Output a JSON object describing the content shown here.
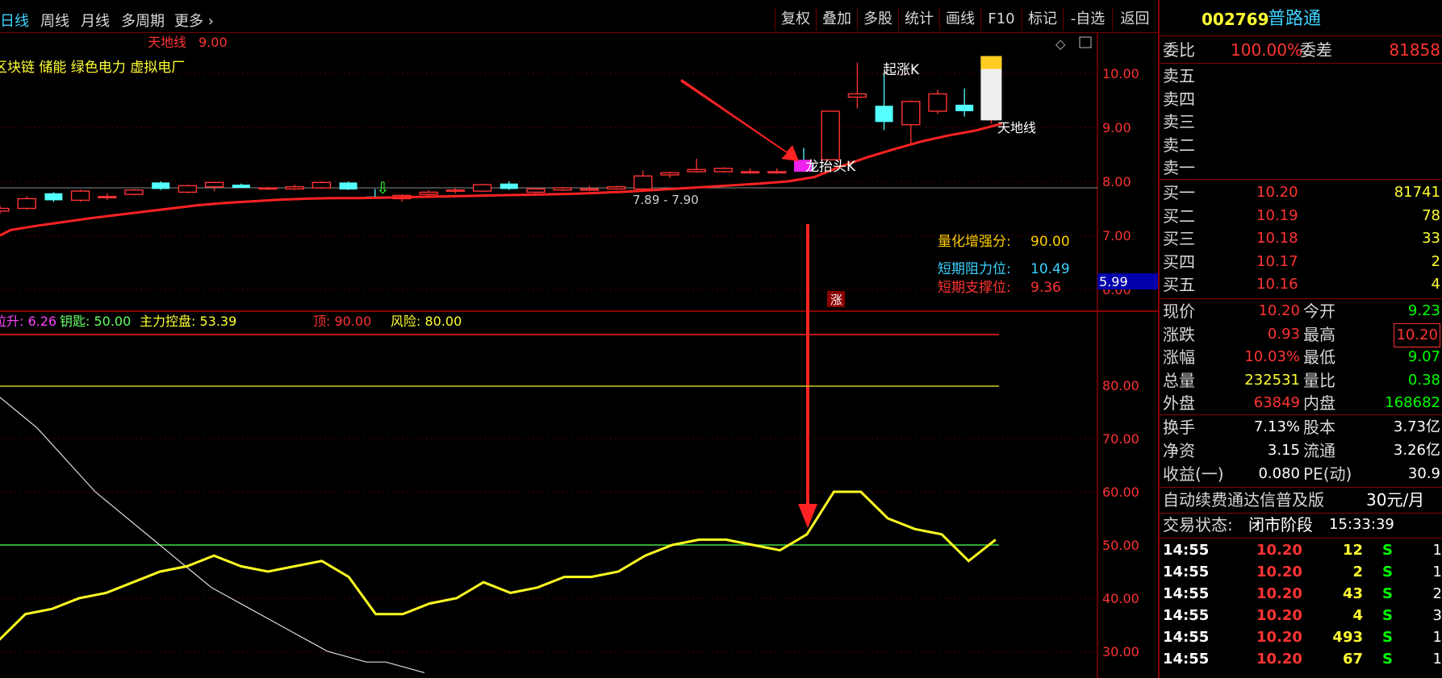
{
  "toolbar": {
    "periods": [
      "日线",
      "周线",
      "月线",
      "多周期",
      "更多"
    ],
    "buttons": [
      "复权",
      "叠加",
      "多股",
      "统计",
      "画线",
      "F10",
      "标记",
      "-自选",
      "返回"
    ]
  },
  "main_chart": {
    "indicator_label": "天地线",
    "indicator_value": "9.00",
    "concepts": "区块链 储能 绿色电力 虚拟电厂",
    "annotations": {
      "dragon_head": "龙抬头K",
      "rise_k": "起涨K",
      "tiandi_line": "天地线",
      "range": "7.89 - 7.90",
      "up_badge": "涨"
    },
    "y_axis_ticks": [
      "10.00",
      "9.00",
      "8.00",
      "7.00",
      "6.00"
    ],
    "cursor_value": "5.99",
    "info": [
      {
        "label": "量化增强分:",
        "value": "90.00",
        "color": "#ffcc00"
      },
      {
        "label": "短期阻力位:",
        "value": "10.49",
        "color": "#3cd2ff"
      },
      {
        "label": "短期支撑位:",
        "value": "9.36",
        "color": "#ff3333"
      }
    ]
  },
  "sub_chart": {
    "legend": [
      {
        "label": "拉升:",
        "value": "6.26",
        "color": "#ff44ff"
      },
      {
        "label": "钥匙:",
        "value": "50.00",
        "color": "#66ff66"
      },
      {
        "label": "主力控盘:",
        "value": "53.39",
        "color": "#ffff33"
      },
      {
        "label": "顶:",
        "value": "90.00",
        "color": "#ff3333"
      },
      {
        "label": "风险:",
        "value": "80.00",
        "color": "#ffff33"
      }
    ],
    "y_axis_ticks": [
      "80.00",
      "70.00",
      "60.00",
      "50.00",
      "40.00",
      "30.00"
    ]
  },
  "quote": {
    "code": "002769",
    "name": "普路通",
    "webi": {
      "label": "委比",
      "value": "100.00%",
      "label2": "委差",
      "value2": "81858"
    },
    "asks": [
      {
        "label": "卖五"
      },
      {
        "label": "卖四"
      },
      {
        "label": "卖三"
      },
      {
        "label": "卖二"
      },
      {
        "label": "卖一"
      }
    ],
    "bids": [
      {
        "label": "买一",
        "price": "10.20",
        "vol": "81741"
      },
      {
        "label": "买二",
        "price": "10.19",
        "vol": "78"
      },
      {
        "label": "买三",
        "price": "10.18",
        "vol": "33"
      },
      {
        "label": "买四",
        "price": "10.17",
        "vol": "2"
      },
      {
        "label": "买五",
        "price": "10.16",
        "vol": "4"
      }
    ],
    "stats": [
      {
        "l1": "现价",
        "v1": "10.20",
        "c1": "#ff3333",
        "l2": "今开",
        "v2": "9.23",
        "c2": "#00ff00"
      },
      {
        "l1": "涨跌",
        "v1": "0.93",
        "c1": "#ff3333",
        "l2": "最高",
        "v2": "10.20",
        "c2": "#ff3333"
      },
      {
        "l1": "涨幅",
        "v1": "10.03%",
        "c1": "#ff3333",
        "l2": "最低",
        "v2": "9.07",
        "c2": "#00ff00"
      },
      {
        "l1": "总量",
        "v1": "232531",
        "c1": "#ffff33",
        "l2": "量比",
        "v2": "0.38",
        "c2": "#00ff00"
      },
      {
        "l1": "外盘",
        "v1": "63849",
        "c1": "#ff3333",
        "l2": "内盘",
        "v2": "168682",
        "c2": "#00ff00"
      }
    ],
    "fundamentals": [
      {
        "l1": "换手",
        "v1": "7.13%",
        "l2": "股本",
        "v2": "3.73亿"
      },
      {
        "l1": "净资",
        "v1": "3.15",
        "l2": "流通",
        "v2": "3.26亿"
      },
      {
        "l1": "收益(一)",
        "v1": "0.080",
        "l2": "PE(动)",
        "v2": "30.9"
      }
    ],
    "notice": {
      "text": "自动续费通达信普及版",
      "price": "30元/月"
    },
    "trade_state": {
      "label": "交易状态:",
      "value": "闭市阶段",
      "time": "15:33:39"
    },
    "ticks": [
      {
        "time": "14:55",
        "price": "10.20",
        "vol": "12",
        "side": "S",
        "n": "1"
      },
      {
        "time": "14:55",
        "price": "10.20",
        "vol": "2",
        "side": "S",
        "n": "1"
      },
      {
        "time": "14:55",
        "price": "10.20",
        "vol": "43",
        "side": "S",
        "n": "2"
      },
      {
        "time": "14:55",
        "price": "10.20",
        "vol": "4",
        "side": "S",
        "n": "3"
      },
      {
        "time": "14:55",
        "price": "10.20",
        "vol": "493",
        "side": "S",
        "n": "1"
      },
      {
        "time": "14:55",
        "price": "10.20",
        "vol": "67",
        "side": "S",
        "n": "1"
      }
    ]
  },
  "chart_data": [
    {
      "type": "candlestick",
      "ylim": [
        6.0,
        10.3
      ],
      "candles": [
        {
          "o": 7.45,
          "h": 7.55,
          "l": 7.4,
          "c": 7.5
        },
        {
          "o": 7.5,
          "h": 7.72,
          "l": 7.48,
          "c": 7.68
        },
        {
          "o": 7.78,
          "h": 7.8,
          "l": 7.62,
          "c": 7.65
        },
        {
          "o": 7.65,
          "h": 7.85,
          "l": 7.62,
          "c": 7.82
        },
        {
          "o": 7.72,
          "h": 7.78,
          "l": 7.66,
          "c": 7.72
        },
        {
          "o": 7.76,
          "h": 7.86,
          "l": 7.74,
          "c": 7.84
        },
        {
          "o": 7.98,
          "h": 8.0,
          "l": 7.84,
          "c": 7.86
        },
        {
          "o": 7.8,
          "h": 7.94,
          "l": 7.78,
          "c": 7.92
        },
        {
          "o": 7.9,
          "h": 8.0,
          "l": 7.82,
          "c": 7.98
        },
        {
          "o": 7.94,
          "h": 7.96,
          "l": 7.88,
          "c": 7.88
        },
        {
          "o": 7.87,
          "h": 7.9,
          "l": 7.85,
          "c": 7.88
        },
        {
          "o": 7.86,
          "h": 7.94,
          "l": 7.84,
          "c": 7.9
        },
        {
          "o": 7.88,
          "h": 8.0,
          "l": 7.86,
          "c": 7.98
        },
        {
          "o": 7.98,
          "h": 8.0,
          "l": 7.84,
          "c": 7.85
        },
        {
          "o": 7.72,
          "h": 7.86,
          "l": 7.68,
          "c": 7.7
        },
        {
          "o": 7.68,
          "h": 7.76,
          "l": 7.62,
          "c": 7.74
        },
        {
          "o": 7.76,
          "h": 7.84,
          "l": 7.72,
          "c": 7.8
        },
        {
          "o": 7.82,
          "h": 7.88,
          "l": 7.78,
          "c": 7.84
        },
        {
          "o": 7.82,
          "h": 7.94,
          "l": 7.8,
          "c": 7.94
        },
        {
          "o": 7.96,
          "h": 8.0,
          "l": 7.84,
          "c": 7.86
        },
        {
          "o": 7.8,
          "h": 7.88,
          "l": 7.76,
          "c": 7.86
        },
        {
          "o": 7.84,
          "h": 7.9,
          "l": 7.82,
          "c": 7.88
        },
        {
          "o": 7.86,
          "h": 7.92,
          "l": 7.82,
          "c": 7.86
        },
        {
          "o": 7.86,
          "h": 7.92,
          "l": 7.84,
          "c": 7.9
        },
        {
          "o": 7.86,
          "h": 8.2,
          "l": 7.8,
          "c": 8.1
        },
        {
          "o": 8.12,
          "h": 8.18,
          "l": 8.06,
          "c": 8.16
        },
        {
          "o": 8.18,
          "h": 8.42,
          "l": 8.16,
          "c": 8.22
        },
        {
          "o": 8.18,
          "h": 8.26,
          "l": 8.16,
          "c": 8.24
        },
        {
          "o": 8.18,
          "h": 8.24,
          "l": 8.14,
          "c": 8.18
        },
        {
          "o": 8.16,
          "h": 8.24,
          "l": 8.14,
          "c": 8.18
        },
        {
          "o": 8.32,
          "h": 8.62,
          "l": 8.18,
          "c": 8.18
        },
        {
          "o": 8.4,
          "h": 9.3,
          "l": 8.4,
          "c": 9.3
        },
        {
          "o": 9.56,
          "h": 10.2,
          "l": 9.35,
          "c": 9.62
        },
        {
          "o": 9.4,
          "h": 10.0,
          "l": 8.95,
          "c": 9.1
        },
        {
          "o": 9.05,
          "h": 9.5,
          "l": 8.7,
          "c": 9.48
        },
        {
          "o": 9.3,
          "h": 9.7,
          "l": 9.25,
          "c": 9.62
        },
        {
          "o": 9.42,
          "h": 9.72,
          "l": 9.2,
          "c": 9.3
        },
        {
          "o": 9.23,
          "h": 10.2,
          "l": 9.07,
          "c": 10.2
        }
      ],
      "ma_line": [
        7.0,
        7.1,
        7.18,
        7.25,
        7.32,
        7.38,
        7.44,
        7.5,
        7.56,
        7.6,
        7.63,
        7.66,
        7.68,
        7.69,
        7.69,
        7.7,
        7.71,
        7.72,
        7.73,
        7.74,
        7.75,
        7.76,
        7.77,
        7.79,
        7.81,
        7.84,
        7.87,
        7.9,
        7.93,
        7.96,
        8.0,
        8.08,
        8.28,
        8.45,
        8.6,
        8.74,
        8.85,
        8.94,
        9.07
      ]
    },
    {
      "type": "line",
      "ylim": [
        25,
        100
      ],
      "series": [
        {
          "name": "主力控盘",
          "values": [
            32,
            37,
            38,
            40,
            41,
            43,
            45,
            46,
            48,
            46,
            45,
            46,
            47,
            44,
            37,
            37,
            39,
            40,
            43,
            41,
            42,
            44,
            44,
            45,
            48,
            50,
            51,
            51,
            50,
            49,
            52,
            60,
            60,
            55,
            53,
            52,
            47,
            51
          ]
        },
        {
          "name": "白线",
          "values": [
            78,
            75,
            72,
            68,
            64,
            60,
            57,
            54,
            51,
            48,
            45,
            42,
            40,
            38,
            36,
            34,
            32,
            30,
            29,
            28,
            28,
            27,
            26
          ]
        }
      ],
      "hlines": [
        {
          "name": "顶",
          "value": 90
        },
        {
          "name": "风险",
          "value": 80
        },
        {
          "name": "钥匙",
          "value": 50
        }
      ]
    }
  ]
}
